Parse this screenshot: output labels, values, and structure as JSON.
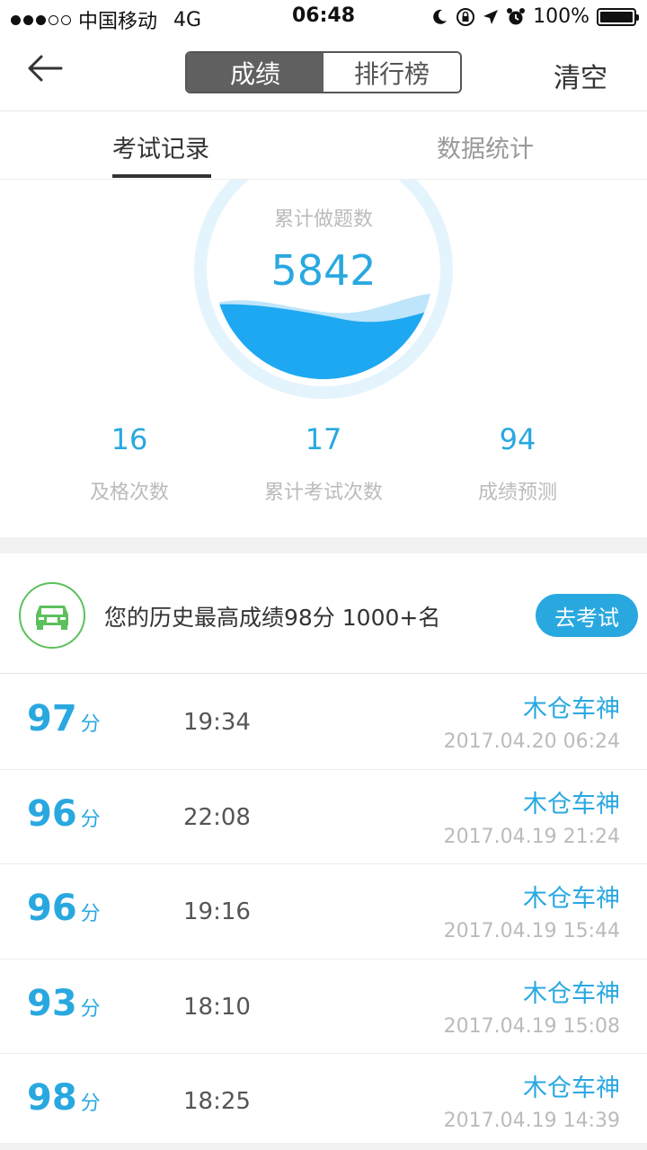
{
  "status_bar": {
    "carrier": "中国移动",
    "network": "4G",
    "time": "06:48",
    "battery": "100%"
  },
  "nav": {
    "segments": [
      "成绩",
      "排行榜"
    ],
    "active_segment": "成绩",
    "clear_label": "清空"
  },
  "tabs": [
    {
      "label": "考试记录",
      "active": true
    },
    {
      "label": "数据统计",
      "active": false
    }
  ],
  "gauge": {
    "label": "累计做题数",
    "value": "5842"
  },
  "stats": [
    {
      "value": "16",
      "label": "及格次数"
    },
    {
      "value": "17",
      "label": "累计考试次数"
    },
    {
      "value": "94",
      "label": "成绩预测"
    }
  ],
  "promo": {
    "text": "您的历史最高成绩98分 1000+名",
    "button_label": "去考试"
  },
  "records": [
    {
      "score": "97",
      "unit": "分",
      "duration": "19:34",
      "name": "木仓车神",
      "date": "2017.04.20 06:24"
    },
    {
      "score": "96",
      "unit": "分",
      "duration": "22:08",
      "name": "木仓车神",
      "date": "2017.04.19 21:24"
    },
    {
      "score": "96",
      "unit": "分",
      "duration": "19:16",
      "name": "木仓车神",
      "date": "2017.04.19 15:44"
    },
    {
      "score": "93",
      "unit": "分",
      "duration": "18:10",
      "name": "木仓车神",
      "date": "2017.04.19 15:08"
    },
    {
      "score": "98",
      "unit": "分",
      "duration": "18:25",
      "name": "木仓车神",
      "date": "2017.04.19 14:39"
    }
  ],
  "colors": {
    "accent": "#29a8e0",
    "wave": "#1ea8f2",
    "car_badge": "#5cc05c",
    "segment_active": "#606060"
  }
}
